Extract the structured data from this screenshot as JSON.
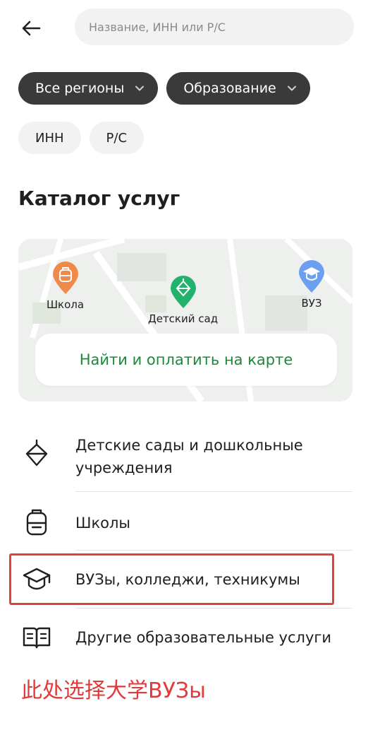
{
  "search": {
    "placeholder": "Название, ИНН или Р/С"
  },
  "filters": {
    "region": "Все регионы",
    "category": "Образование",
    "inn": "ИНН",
    "rs": "Р/С"
  },
  "catalog": {
    "title": "Каталог услуг",
    "map": {
      "pins": [
        "Школа",
        "Детский сад",
        "ВУЗ"
      ],
      "button": "Найти и оплатить на карте"
    },
    "items": [
      {
        "label_line1": "Детские сады и дошкольные",
        "label_line2": "учреждения",
        "icon": "spinning-top-icon"
      },
      {
        "label": "Школы",
        "icon": "backpack-icon"
      },
      {
        "label": "ВУЗы, колледжи, техникумы",
        "icon": "graduation-cap-icon"
      },
      {
        "label": "Другие образовательные услуги",
        "icon": "open-book-icon"
      }
    ]
  },
  "annotation": "此处选择大学ВУЗы",
  "colors": {
    "accent_green": "#1a8a3a",
    "chip_dark": "#3a3a3a",
    "highlight_red": "#e04040"
  }
}
